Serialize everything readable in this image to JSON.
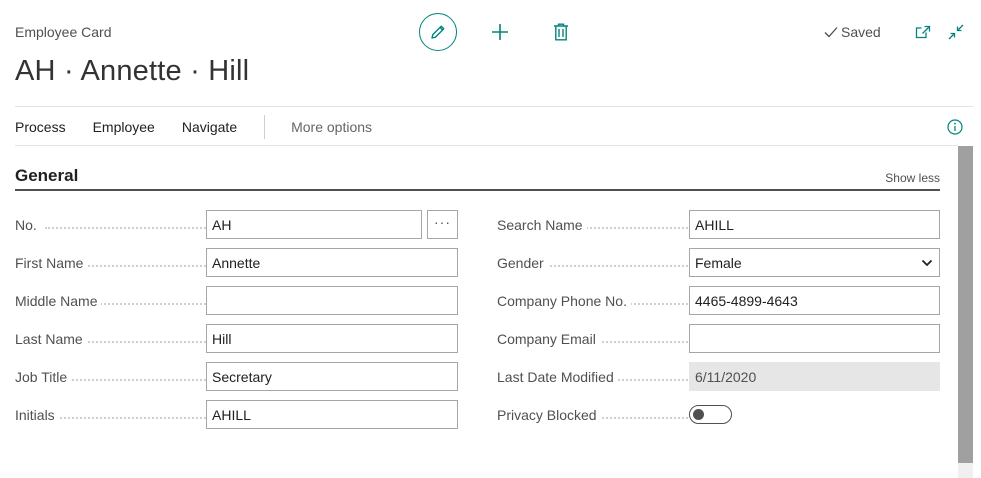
{
  "header": {
    "caption": "Employee Card",
    "title": "AH · Annette · Hill",
    "status": "Saved"
  },
  "toolbar": {
    "edit_icon": "pencil-icon",
    "new_icon": "plus-icon",
    "delete_icon": "trash-icon",
    "popout_icon": "open-in-new-window-icon",
    "collapse_icon": "collapse-icon"
  },
  "actions": {
    "items": [
      "Process",
      "Employee",
      "Navigate"
    ],
    "more": "More options"
  },
  "section": {
    "title": "General",
    "toggle_label": "Show less"
  },
  "fields_left": [
    {
      "label": "No.",
      "value": "AH"
    },
    {
      "label": "First Name",
      "value": "Annette"
    },
    {
      "label": "Middle Name",
      "value": ""
    },
    {
      "label": "Last Name",
      "value": "Hill"
    },
    {
      "label": "Job Title",
      "value": "Secretary"
    },
    {
      "label": "Initials",
      "value": "AHILL"
    }
  ],
  "fields_right": [
    {
      "label": "Search Name",
      "value": "AHILL"
    },
    {
      "label": "Gender",
      "value": "Female",
      "options": [
        "Female"
      ]
    },
    {
      "label": "Company Phone No.",
      "value": "4465-4899-4643"
    },
    {
      "label": "Company Email",
      "value": ""
    },
    {
      "label": "Last Date Modified",
      "value": "6/11/2020"
    },
    {
      "label": "Privacy Blocked",
      "value": false
    }
  ],
  "lookup_label": "···",
  "colors": {
    "accent": "#00857c",
    "text": "#212121",
    "label": "#505050"
  }
}
